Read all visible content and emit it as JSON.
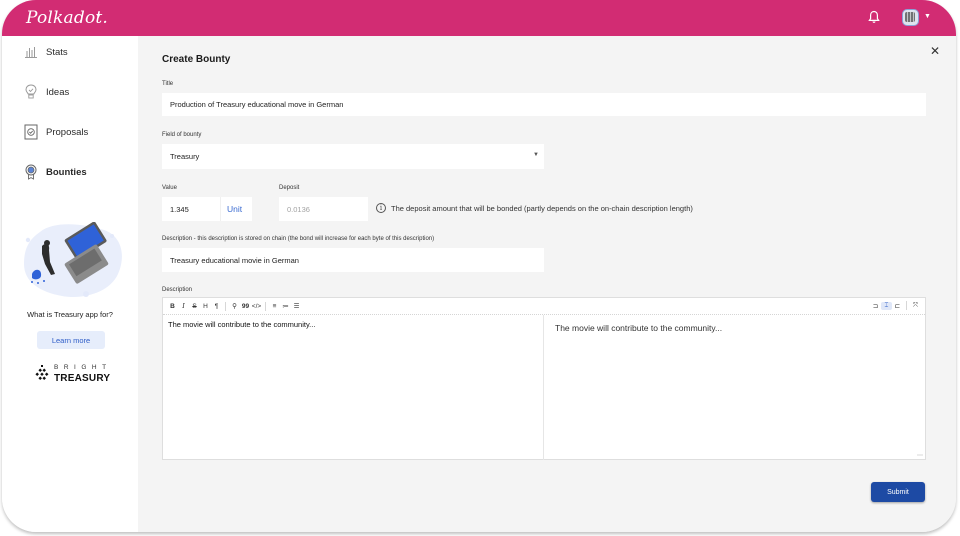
{
  "app": {
    "logo": "Polkadot.",
    "icons": {
      "network_menu": "chevron-down-icon",
      "notifications": "bell-icon",
      "account": "identicon-avatar",
      "account_menu": "chevron-down-icon"
    }
  },
  "sidebar": {
    "items": [
      {
        "label": "Stats",
        "icon": "bar-chart-icon",
        "active": false
      },
      {
        "label": "Ideas",
        "icon": "lightbulb-icon",
        "active": false
      },
      {
        "label": "Proposals",
        "icon": "proposal-document-icon",
        "active": false
      },
      {
        "label": "Bounties",
        "icon": "award-medal-icon",
        "active": true
      }
    ],
    "promo_question": "What is Treasury app for?",
    "learn_more_label": "Learn more",
    "brand_top": "BRIGHT",
    "brand_bottom": "TREASURY"
  },
  "form": {
    "title": "Create Bounty",
    "close_icon": "close-icon",
    "title_label": "Title",
    "title_value": "Production of Treasury educational move in German",
    "field_label": "Field of bounty",
    "field_value": "Treasury",
    "value_label": "Value",
    "value_value": "1.345",
    "unit_label": "Unit",
    "deposit_label": "Deposit",
    "deposit_value": "0.0136",
    "deposit_info": "The deposit amount that will be bonded (partly depends on the on-chain description length)",
    "onchain_desc_label": "Description - this description is stored on chain (the bond will increase for each byte of this description)",
    "onchain_desc_value": "Treasury educational movie in German",
    "description_label": "Description",
    "editor_toolbar": [
      "B",
      "I",
      "S",
      "H",
      "¶",
      "🔗",
      "99",
      "</>",
      "≡",
      "≔",
      "☰"
    ],
    "editor_toolbar_names": [
      "bold",
      "italic",
      "strikethrough",
      "heading",
      "paragraph",
      "link",
      "quote",
      "code",
      "bullet-list",
      "numbered-list",
      "checklist"
    ],
    "editor_right_tools": [
      "editor-only",
      "split-view",
      "preview-only",
      "fullscreen"
    ],
    "editor_text": "The movie will contribute to the community...",
    "preview_text": "The movie will contribute to the community...",
    "submit_label": "Submit"
  }
}
